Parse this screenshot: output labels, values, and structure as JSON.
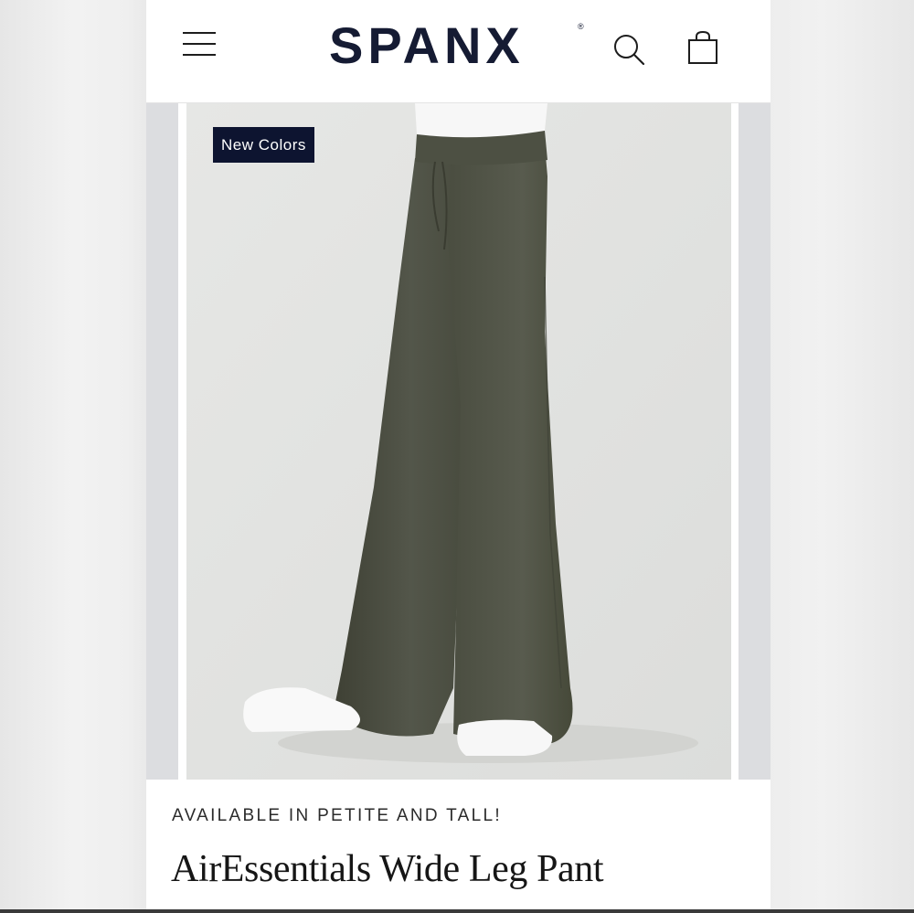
{
  "header": {
    "brand": "SPANX",
    "brand_mark": "®",
    "menu_icon": "hamburger-menu-icon",
    "search_icon": "search-icon",
    "cart_icon": "shopping-bag-icon"
  },
  "carousel": {
    "badge": "New Colors",
    "product_color": "#4b4d3f"
  },
  "product": {
    "eyebrow": "AVAILABLE IN PETITE AND TALL!",
    "title": "AirEssentials Wide Leg Pant"
  },
  "colors": {
    "brand_navy": "#151b33",
    "badge_bg": "#0d1430",
    "image_bg": "#e4e5e3"
  }
}
